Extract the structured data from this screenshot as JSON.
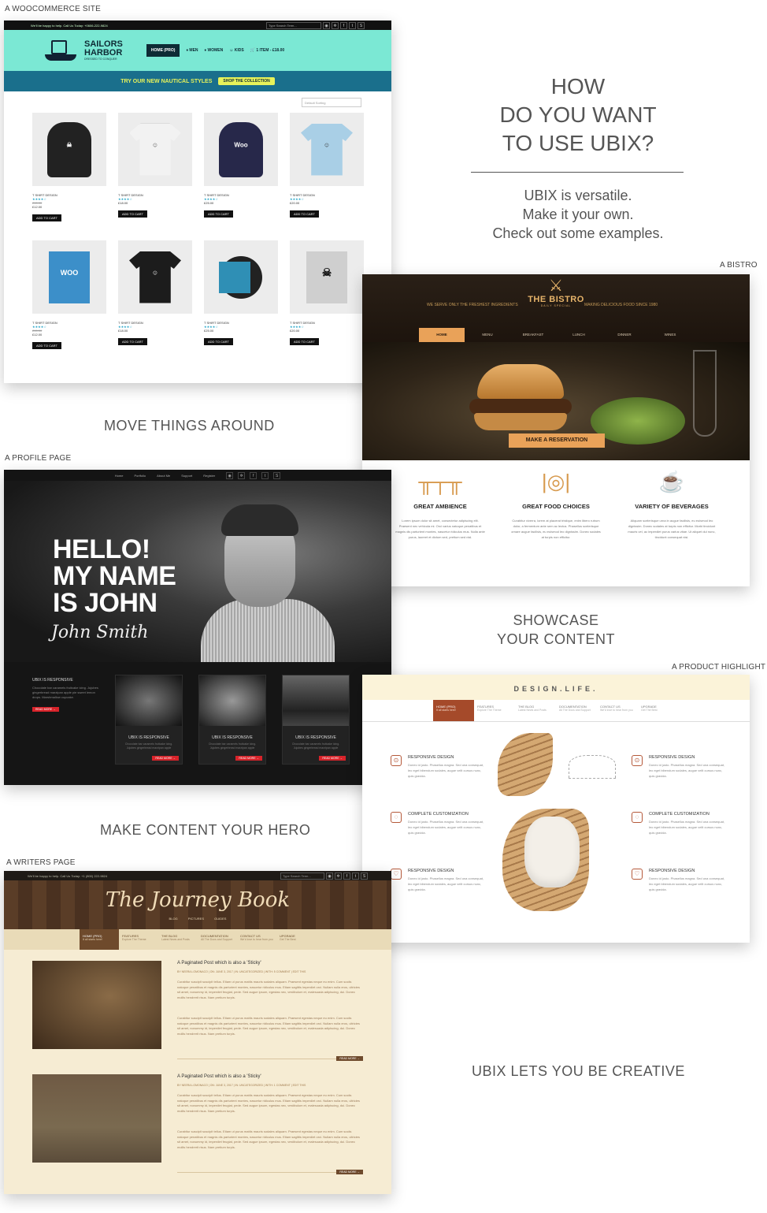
{
  "captions": {
    "woo": "A WOOCOMMERCE SITE",
    "bistro": "A BISTRO",
    "profile": "A PROFILE PAGE",
    "product": "A PRODUCT HIGHLIGHT",
    "writers": "A WRITERS PAGE",
    "move": "MOVE THINGS AROUND",
    "showcase_1": "SHOWCASE",
    "showcase_2": "YOUR CONTENT",
    "hero": "MAKE CONTENT YOUR HERO",
    "creative": "UBIX LETS YOU BE CREATIVE"
  },
  "headline": {
    "line1": "HOW",
    "line2": "DO YOU WANT",
    "line3": "TO USE UBIX?",
    "sub1": "UBIX is versatile.",
    "sub2": "Make it your own.",
    "sub3": "Check out some examples."
  },
  "woo": {
    "topbar": "We'll be happy to help. Call Us Today: +0606-222-9824",
    "search_placeholder": "Type Search Term...",
    "logo_line1": "SAILORS",
    "logo_line2": "HARBOR",
    "logo_tag": "DRESSED TO CONQUER",
    "nav": [
      "HOME (PRO)",
      "MEN",
      "WOMEN",
      "KIDS",
      "1 ITEM - £18.00"
    ],
    "banner": "TRY OUR NEW NAUTICAL STYLES",
    "banner_btn": "SHOP THE COLLECTION",
    "sort": "Default Sorting",
    "products": [
      {
        "name": "T SHIRT DESIGN",
        "stars": "★★★★☆",
        "old": "£15.00",
        "price": "£12.00",
        "btn": "ADD TO CART"
      },
      {
        "name": "T SHIRT DESIGN",
        "stars": "★★★★☆",
        "old": "",
        "price": "£18.00",
        "btn": "ADD TO CART"
      },
      {
        "name": "T SHIRT DESIGN",
        "stars": "★★★★☆",
        "old": "",
        "price": "£25.00",
        "btn": "ADD TO CART"
      },
      {
        "name": "T SHIRT DESIGN",
        "stars": "★★★★☆",
        "old": "",
        "price": "£20.00",
        "btn": "ADD TO CART"
      },
      {
        "name": "T SHIRT DESIGN",
        "stars": "★★★★☆",
        "old": "£15.00",
        "price": "£12.00",
        "btn": "ADD TO CART"
      },
      {
        "name": "T SHIRT DESIGN",
        "stars": "★★★★☆",
        "old": "",
        "price": "£18.00",
        "btn": "ADD TO CART"
      },
      {
        "name": "T SHIRT DESIGN",
        "stars": "★★★★☆",
        "old": "",
        "price": "£25.00",
        "btn": "ADD TO CART"
      },
      {
        "name": "T SHIRT DESIGN",
        "stars": "★★★★☆",
        "old": "",
        "price": "£20.00",
        "btn": "ADD TO CART"
      }
    ]
  },
  "bistro": {
    "tag_left": "WE SERVE ONLY THE FRESHEST INGREDIENTS",
    "tag_right": "MAKING DELICIOUS FOOD SINCE 1980",
    "logo": "THE BISTRO",
    "logo_sub": "DAILY SPECIAL",
    "nav": [
      "HOME",
      "MENU",
      "BREAKFAST",
      "LUNCH",
      "DINNER",
      "WINES"
    ],
    "cta": "MAKE A RESERVATION",
    "features": [
      {
        "title": "GREAT AMBIENCE",
        "text": "Lorem ipsum dolor sit amet, consectetur adipiscing elit. Praesent nec vehicula mi. Orci varius natoque penatibus et magnis dis parturient montes, nascetur ridiculus mus. Nulla ante purus, laoreet et dictum sed, pretium sed nisl."
      },
      {
        "title": "GREAT FOOD CHOICES",
        "text": "Curabitur viverra, lorem at placerat tristique, enim libero rutrum dolor, a fermentum ante sem ac lectus. Phasellus scelerisque ornare augue facilisis, eu euismod leo dignissim. Donec sodales at turpis non efficitur."
      },
      {
        "title": "VARIETY OF BEVERAGES",
        "text": "Aliquam scelerisque urna in augue facilisis, eu euismod leo dignissim. Donec sodales at turpis non efficitur. Morbi tincidunt mauris vel, ac imperdiet purus varius vitae. Ut aliquet dui nunc, tincidunt consequat nisi."
      }
    ]
  },
  "profile": {
    "nav": [
      "Home",
      "Portfolio",
      "About Me",
      "Support",
      "Register"
    ],
    "hello1": "HELLO!",
    "hello2": "MY NAME",
    "hello3": "IS JOHN",
    "signature": "John Smith",
    "intro_title": "UBIX IS RESPONSIVE",
    "intro_text": "Chocolate bar caramels fruitcake icing. Jujubes gingerbread marzipan apple pie sweet lemon drops. Marshmallow cupcake.",
    "read_more": "READ MORE →",
    "cards": [
      {
        "title": "UBIX IS RESPONSIVE",
        "text": "Chocolate bar caramels fruitcake icing. Jujubes gingerbread marzipan apple",
        "btn": "READ MORE →"
      },
      {
        "title": "UBIX IS RESPONSIVE",
        "text": "Chocolate bar caramels fruitcake icing. Jujubes gingerbread marzipan apple",
        "btn": "READ MORE →"
      },
      {
        "title": "UBIX IS RESPONSIVE",
        "text": "Chocolate bar caramels fruitcake icing. Jujubes gingerbread marzipan apple",
        "btn": "READ MORE →"
      }
    ]
  },
  "design": {
    "logo": "DESIGN.LIFE.",
    "nav": [
      {
        "label": "HOME (PRO)",
        "sub": "It all starts here!"
      },
      {
        "label": "FEATURES",
        "sub": "Explore The Theme"
      },
      {
        "label": "THE BLOG",
        "sub": "Latest News and Posts"
      },
      {
        "label": "DOCUMENTATION",
        "sub": "All The Docs and Support"
      },
      {
        "label": "CONTACT US",
        "sub": "We'd love to hear from you"
      },
      {
        "label": "UPGRADE",
        "sub": "Get The Best"
      }
    ],
    "features": [
      {
        "title": "RESPONSIVE DESIGN",
        "text": "Donec id justo. Phasellus magna. Sed una consequat, leo eget bibendum sodales, augue velit cursus nunc, quis gravida."
      },
      {
        "title": "RESPONSIVE DESIGN",
        "text": "Donec id justo. Phasellus magna. Sed una consequat, leo eget bibendum sodales, augue velit cursus nunc, quis gravida."
      },
      {
        "title": "COMPLETE CUSTOMIZATION",
        "text": "Donec id justo. Phasellus magna. Sed una consequat, leo eget bibendum sodales, augue velit cursus nunc, quis gravida."
      },
      {
        "title": "COMPLETE CUSTOMIZATION",
        "text": "Donec id justo. Phasellus magna. Sed una consequat, leo eget bibendum sodales, augue velit cursus nunc, quis gravida."
      },
      {
        "title": "RESPONSIVE DESIGN",
        "text": "Donec id justo. Phasellus magna. Sed una consequat, leo eget bibendum sodales, augue velit cursus nunc, quis gravida."
      },
      {
        "title": "RESPONSIVE DESIGN",
        "text": "Donec id justo. Phasellus magna. Sed una consequat, leo eget bibendum sodales, augue velit cursus nunc, quis gravida."
      }
    ]
  },
  "writers": {
    "topbar": "We'll be happy to help. Call Us Today: +1 (800) 222-9824",
    "search_placeholder": "Type Search Term...",
    "title": "The Journey Book",
    "subnav": "BLOG PICTURES GUIDES",
    "nav": [
      {
        "label": "HOME (PRO)",
        "sub": "It all starts here!"
      },
      {
        "label": "FEATURES",
        "sub": "Explore The Theme"
      },
      {
        "label": "THE BLOG",
        "sub": "Latest News and Posts"
      },
      {
        "label": "DOCUMENTATION",
        "sub": "All The Docs and Support"
      },
      {
        "label": "CONTACT US",
        "sub": "We'd love to hear from you"
      },
      {
        "label": "UPGRADE",
        "sub": "Get The Best"
      }
    ],
    "posts": [
      {
        "title": "A Paginated Post which is also a 'Sticky'",
        "meta": "BY NEERA LOMONACO | ON: JUNE 3, 2017 | IN: UNCATEGORIZED | WITH: 5 COMMENT | EDIT THIS",
        "p1": "Curabitur suscipit suscipit tellus. Etiam ut purus mattis mauris sodales aliquam. Praesent egestas neque eu enim. Cum sociis natoque penatibus et magnis dis parturient montes, nascetur ridiculus mus. Etiam sagittis imperdiet orci. Nullam nulla eros, ultricies sit amet, nonummy id, imperdiet feugiat, pede. Sed augue ipsum, egestas nec, vestibulum et, malesuada adipiscing, dui. Donec mollis hendrerit risus. Nam pretium turpis.",
        "p2": "Curabitur suscipit suscipit tellus. Etiam ut purus mattis mauris sodales aliquam. Praesent egestas neque eu enim. Cum sociis natoque penatibus et magnis dis parturient montes, nascetur ridiculus mus. Etiam sagittis imperdiet orci. Nullam nulla eros, ultricies sit amet, nonummy id, imperdiet feugiat, pede. Sed augue ipsum, egestas nec, vestibulum et, malesuada adipiscing, dui. Donec mollis hendrerit risus. Nam pretium turpis.",
        "more": "READ MORE →"
      },
      {
        "title": "A Paginated Post which is also a 'Sticky'",
        "meta": "BY NEERA LOMONACO | ON: JUNE 3, 2017 | IN: UNCATEGORIZED | WITH: 1 COMMENT | EDIT THIS",
        "p1": "Curabitur suscipit suscipit tellus. Etiam ut purus mattis mauris sodales aliquam. Praesent egestas neque eu enim. Cum sociis natoque penatibus et magnis dis parturient montes, nascetur ridiculus mus. Etiam sagittis imperdiet orci. Nullam nulla eros, ultricies sit amet, nonummy id, imperdiet feugiat, pede. Sed augue ipsum, egestas nec, vestibulum et, malesuada adipiscing, dui. Donec mollis hendrerit risus. Nam pretium turpis.",
        "p2": "Curabitur suscipit suscipit tellus. Etiam ut purus mattis mauris sodales aliquam. Praesent egestas neque eu enim. Cum sociis natoque penatibus et magnis dis parturient montes, nascetur ridiculus mus. Etiam sagittis imperdiet orci. Nullam nulla eros, ultricies sit amet, nonummy id, imperdiet feugiat, pede. Sed augue ipsum, egestas nec, vestibulum et, malesuada adipiscing, dui. Donec mollis hendrerit risus. Nam pretium turpis.",
        "more": "READ MORE →"
      }
    ]
  },
  "colors": {
    "woo_teal": "#7be8d4",
    "bistro_orange": "#e9a259",
    "profile_red": "#d8232a",
    "design_rust": "#a54a2a",
    "writers_brown": "#6e4a2c"
  }
}
